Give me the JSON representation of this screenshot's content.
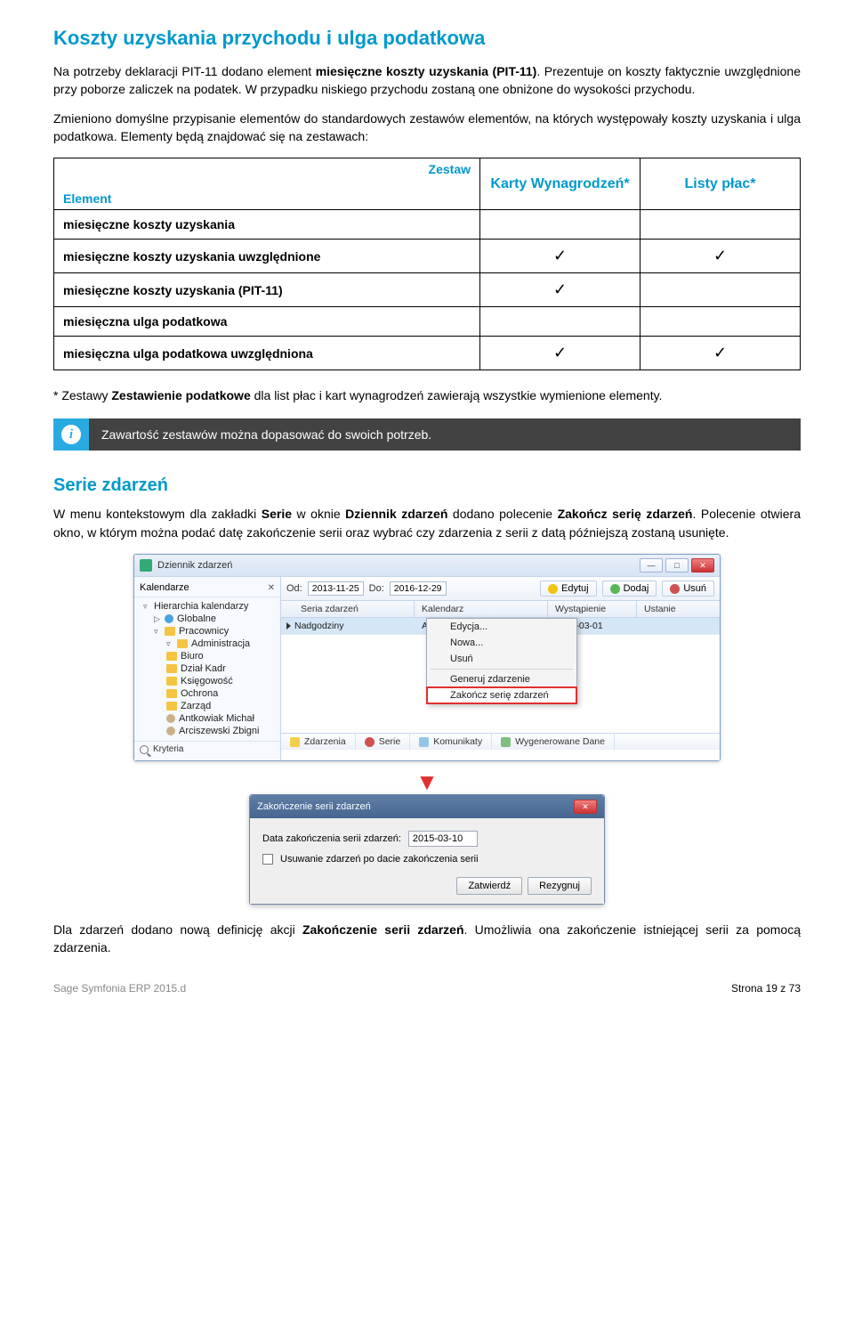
{
  "heading1": "Koszty uzyskania przychodu i ulga podatkowa",
  "para1_a": "Na potrzeby deklaracji PIT-11 dodano element ",
  "para1_bold": "miesięczne koszty uzyskania (PIT-11)",
  "para1_b": ". Prezentuje on koszty faktycznie uwzględnione przy poborze zaliczek na podatek. W przypadku niskiego przychodu zostaną one obniżone do wysokości przychodu.",
  "para2": "Zmieniono domyślne przypisanie elementów do standardowych zestawów elementów, na których występowały koszty uzyskania i ulga podatkowa. Elementy będą znajdować się na zestawach:",
  "matrix": {
    "corner_top": "Zestaw",
    "corner_bottom": "Element",
    "col1": "Karty Wynagrodzeń*",
    "col2": "Listy płac*",
    "rows": [
      {
        "label": "miesięczne koszty uzyskania",
        "c1": "",
        "c2": ""
      },
      {
        "label": "miesięczne koszty uzyskania uwzględnione",
        "c1": "✓",
        "c2": "✓"
      },
      {
        "label": "miesięczne koszty uzyskania (PIT-11)",
        "c1": "✓",
        "c2": ""
      },
      {
        "label": "miesięczna ulga podatkowa",
        "c1": "",
        "c2": ""
      },
      {
        "label": "miesięczna ulga podatkowa uwzględniona",
        "c1": "✓",
        "c2": "✓"
      }
    ]
  },
  "note_a": "* Zestawy ",
  "note_bold": "Zestawienie podatkowe",
  "note_b": " dla list płac i kart wynagrodzeń zawierają wszystkie wymienione elementy.",
  "info_text": "Zawartość zestawów można dopasować do swoich potrzeb.",
  "heading2": "Serie zdarzeń",
  "para3_a": "W menu kontekstowym dla zakładki ",
  "para3_bold1": "Serie",
  "para3_b": " w oknie ",
  "para3_bold2": "Dziennik zdarzeń",
  "para3_c": " dodano polecenie ",
  "para3_bold3": "Zakończ serię zdarzeń",
  "para3_d": ". Polecenie otwiera okno, w którym można podać datę zakończenie serii oraz wybrać czy zdarzenia z serii z datą późniejszą zostaną usunięte.",
  "app": {
    "title": "Dziennik zdarzeń",
    "sidebar": {
      "tab": "Kalendarze",
      "root": "Hierarchia kalendarzy",
      "items": [
        {
          "icon": "globe",
          "label": "Globalne",
          "caret": "▷",
          "indent": 1
        },
        {
          "icon": "folder",
          "label": "Pracownicy",
          "caret": "▿",
          "indent": 1
        },
        {
          "icon": "folder",
          "label": "Administracja",
          "caret": "▿",
          "indent": 2
        },
        {
          "icon": "folder",
          "label": "Biuro",
          "caret": "",
          "indent": 2
        },
        {
          "icon": "folder",
          "label": "Dział Kadr",
          "caret": "",
          "indent": 2
        },
        {
          "icon": "folder",
          "label": "Księgowość",
          "caret": "",
          "indent": 2
        },
        {
          "icon": "folder",
          "label": "Ochrona",
          "caret": "",
          "indent": 2
        },
        {
          "icon": "folder",
          "label": "Zarząd",
          "caret": "",
          "indent": 2
        },
        {
          "icon": "person",
          "label": "Antkowiak Michał",
          "caret": "",
          "indent": 2
        },
        {
          "icon": "person",
          "label": "Arciszewski Zbigni",
          "caret": "",
          "indent": 2
        }
      ],
      "foot": "Kryteria"
    },
    "toolbar": {
      "od": "Od:",
      "od_val": "2013-11-25",
      "do": "Do:",
      "do_val": "2016-12-29",
      "edit": "Edytuj",
      "add": "Dodaj",
      "remove": "Usuń"
    },
    "cols": {
      "c1": "Seria zdarzeń",
      "c2": "Kalendarz",
      "c3": "Wystąpienie",
      "c4": "Ustanie"
    },
    "row": {
      "c1": "Nadgodziny",
      "c2": "Antkowiak Michał",
      "c3": "2015-03-01",
      "c4": ""
    },
    "menu": {
      "m1": "Edycja...",
      "m2": "Nowa...",
      "m3": "Usuń",
      "m4": "Generuj zdarzenie",
      "m5": "Zakończ serię zdarzeń"
    },
    "tabs": {
      "t1": "Zdarzenia",
      "t2": "Serie",
      "t3": "Komunikaty",
      "t4": "Wygenerowane Dane"
    }
  },
  "dialog": {
    "title": "Zakończenie serii zdarzeń",
    "label1": "Data zakończenia serii zdarzeń:",
    "value1": "2015-03-10",
    "label2": "Usuwanie zdarzeń po dacie zakończenia serii",
    "ok": "Zatwierdź",
    "cancel": "Rezygnuj"
  },
  "para4_a": "Dla zdarzeń dodano nową definicję akcji ",
  "para4_bold": "Zakończenie serii zdarzeń",
  "para4_b": ". Umożliwia ona zakończenie istniejącej serii za pomocą zdarzenia.",
  "footer": {
    "left": "Sage Symfonia ERP 2015.d",
    "right": "Strona 19 z 73"
  }
}
